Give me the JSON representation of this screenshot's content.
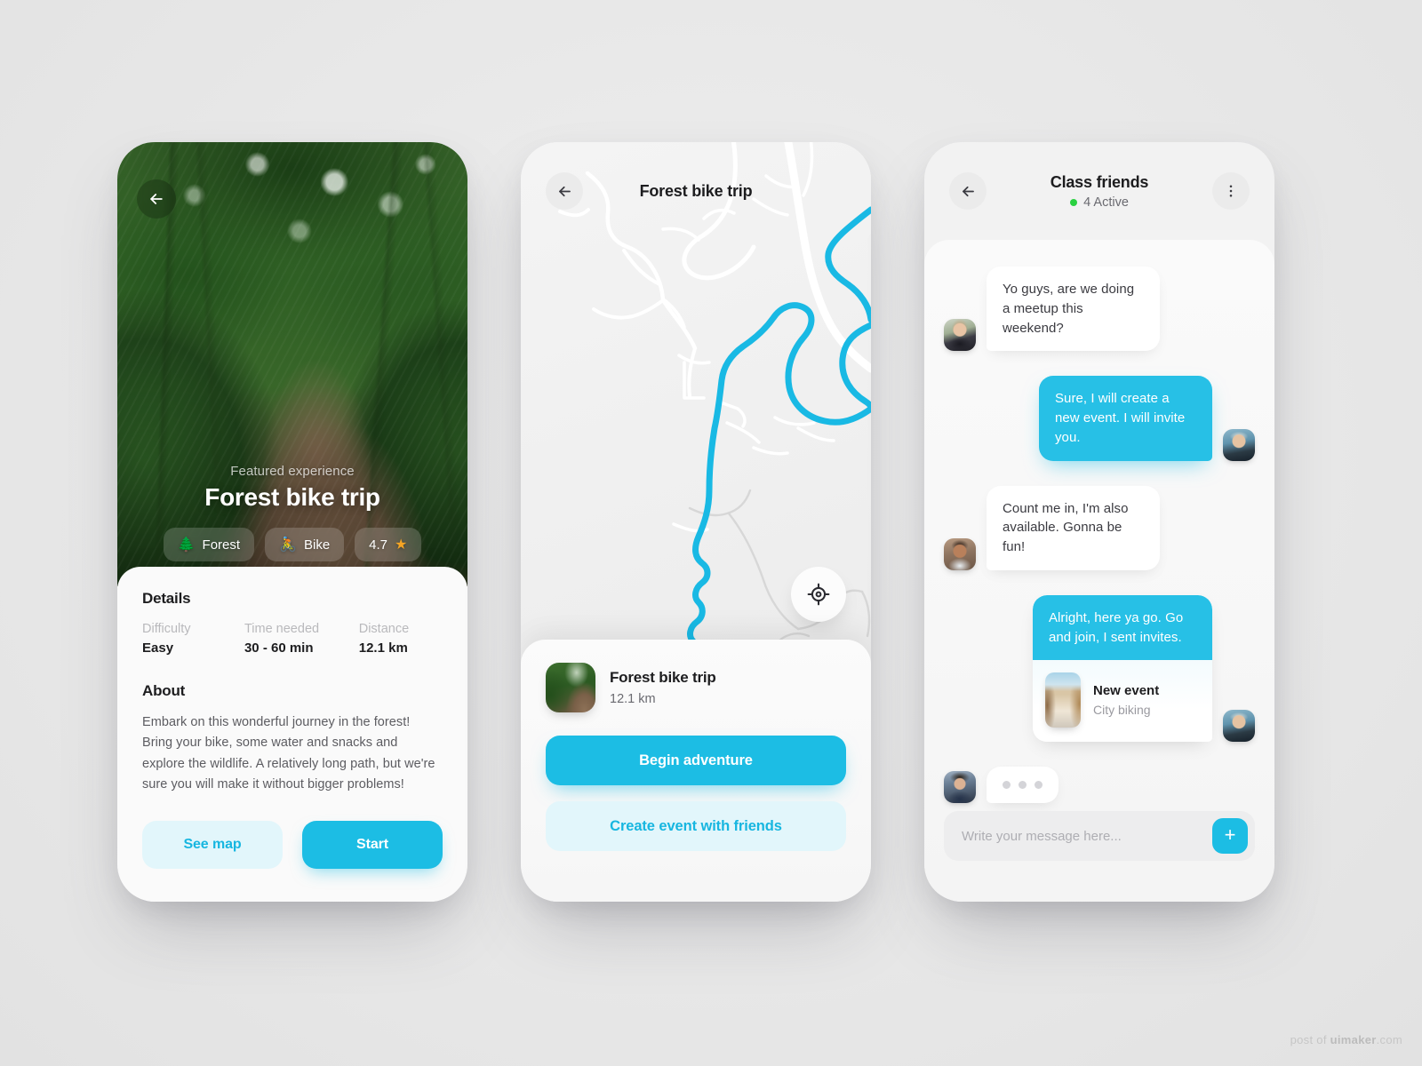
{
  "colors": {
    "accent": "#1cbde4",
    "accent_soft": "#e2f6fb",
    "active_dot": "#2ad141",
    "bubble_out": "#27c0e6"
  },
  "screen_detail": {
    "back_icon": "arrow-left-icon",
    "hero": {
      "featured_label": "Featured experience",
      "title": "Forest bike trip",
      "chips": [
        {
          "icon": "🌲",
          "icon_name": "tree-icon",
          "label": "Forest"
        },
        {
          "icon": "🚴",
          "icon_name": "cyclist-icon",
          "label": "Bike"
        },
        {
          "icon": "★",
          "icon_name": "star-icon",
          "label": "4.7"
        }
      ]
    },
    "details": {
      "heading": "Details",
      "stats": [
        {
          "label": "Difficulty",
          "value": "Easy"
        },
        {
          "label": "Time needed",
          "value": "30 - 60 min"
        },
        {
          "label": "Distance",
          "value": "12.1 km"
        }
      ]
    },
    "about": {
      "heading": "About",
      "text": "Embark on this wonderful journey in the forest! Bring your bike, some water and snacks and explore the wildlife. A relatively long path, but we're sure you will make it without bigger problems!"
    },
    "actions": {
      "secondary": "See map",
      "primary": "Start"
    }
  },
  "screen_map": {
    "title": "Forest bike trip",
    "back_icon": "arrow-left-icon",
    "locate_icon": "crosshair-icon",
    "trip": {
      "name": "Forest bike trip",
      "distance": "12.1 km"
    },
    "buttons": {
      "primary": "Begin adventure",
      "secondary": "Create event with friends"
    }
  },
  "screen_chat": {
    "title": "Class friends",
    "active_status": "4 Active",
    "back_icon": "arrow-left-icon",
    "more_icon": "more-vertical-icon",
    "messages": [
      {
        "side": "in",
        "avatar": "av-f",
        "text": "Yo guys, are we doing a meetup this weekend?"
      },
      {
        "side": "out",
        "avatar": "av-m1",
        "text": "Sure, I will create a new event. I will invite you."
      },
      {
        "side": "in",
        "avatar": "av-m2",
        "text": "Count me in, I'm also available. Gonna be fun!"
      },
      {
        "side": "out",
        "avatar": "av-m1",
        "text": "Alright, here ya go. Go and join, I sent invites.",
        "card": {
          "title": "New event",
          "subtitle": "City biking"
        }
      },
      {
        "side": "in",
        "avatar": "av-m3",
        "typing": true
      }
    ],
    "composer": {
      "placeholder": "Write your message here...",
      "send_icon": "plus-icon"
    }
  },
  "watermark": {
    "prefix": "post of ",
    "brand": "uimaker",
    "suffix": ".com"
  }
}
